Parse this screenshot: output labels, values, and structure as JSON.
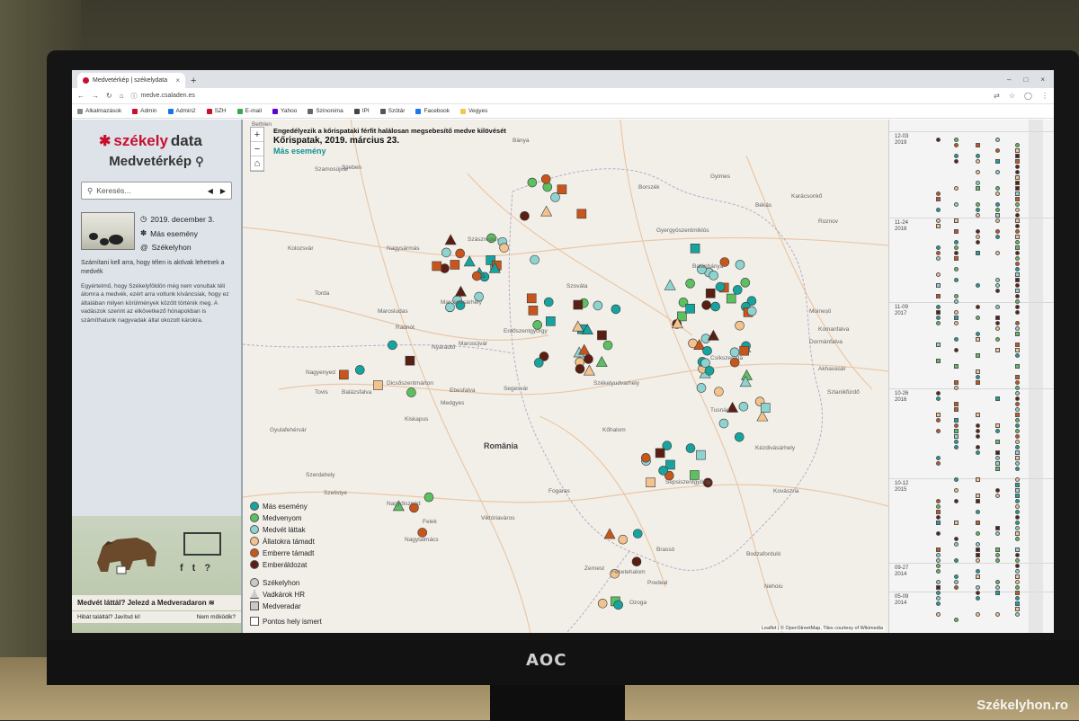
{
  "browser": {
    "tab_title": "Medvetérkép | székelydata",
    "url": "medve.csaladen.es",
    "bookmarks": [
      {
        "label": "Alkalmazások",
        "color": "#888888"
      },
      {
        "label": "Admin",
        "color": "#c8102e"
      },
      {
        "label": "Admin2",
        "color": "#1a73e8"
      },
      {
        "label": "SZH",
        "color": "#c8102e"
      },
      {
        "label": "E-mail",
        "color": "#34a853"
      },
      {
        "label": "Yahoo",
        "color": "#5f01d1"
      },
      {
        "label": "Szinonima",
        "color": "#666666"
      },
      {
        "label": "IPI",
        "color": "#444444"
      },
      {
        "label": "Szótár",
        "color": "#555555"
      },
      {
        "label": "Facebook",
        "color": "#1877f2"
      },
      {
        "label": "Vegyes",
        "color": "#f2c94c"
      }
    ]
  },
  "sidebar": {
    "logo_text_1": "székely",
    "logo_text_2": "data",
    "subtitle": "Medvetérkép",
    "search_placeholder": "Keresés...",
    "event_date": "2019. december 3.",
    "event_type": "Más esemény",
    "event_source": "Székelyhon",
    "lead": "Számítani kell arra, hogy télen is aktívak lehetnek a medvék",
    "body": "Egyértelmű, hogy Székelyföldön még nem vonultak téli álomra a medvék, ezért arra voltunk kíváncsiak, hogy ez általában milyen körülmények között történik meg. A vadászok szerint az elkövetkező hónapokban is számíthatunk nagyvadak által okozott károkra.",
    "cta": "Medvét láttál? Jelezd a Medveradaron",
    "cta_left": "Hibát találtál? Javítsd ki!",
    "cta_right": "Nem működik?",
    "social": [
      "f",
      "t",
      "?"
    ]
  },
  "map": {
    "popup_line1": "Engedélyezik a kőrispataki férfit halálosan megsebesítő medve kilövését",
    "popup_line2": "Kőrispatak, 2019. március 23.",
    "popup_line3": "Más esemény",
    "country_label": "România",
    "attribution": "Leaflet | © OpenStreetMap, Tiles courtesy of Wikimedia",
    "place_labels": [
      {
        "name": "Bethlen"
      },
      {
        "name": "Szamosújvár"
      },
      {
        "name": "Borszék"
      },
      {
        "name": "Karácsonkő"
      },
      {
        "name": "Békás"
      },
      {
        "name": "Gyergyószentmiklós"
      },
      {
        "name": "Roznov"
      },
      {
        "name": "Nagysármás"
      },
      {
        "name": "Kolozsvár"
      },
      {
        "name": "Szászrégen"
      },
      {
        "name": "Marosvásárhely"
      },
      {
        "name": "Torda"
      },
      {
        "name": "Marosludas"
      },
      {
        "name": "Nyárádtő"
      },
      {
        "name": "Radnót"
      },
      {
        "name": "Erdőszentgyörgy"
      },
      {
        "name": "Szováta"
      },
      {
        "name": "Balánbánya"
      },
      {
        "name": "Moinești"
      },
      {
        "name": "Komanfalva"
      },
      {
        "name": "Dormánfalva"
      },
      {
        "name": "Marosújvár"
      },
      {
        "name": "Nagyenyed"
      },
      {
        "name": "Dicsőszentmárton"
      },
      {
        "name": "Székelyudvarhely"
      },
      {
        "name": "Csíkszereda"
      },
      {
        "name": "Akhavasár"
      },
      {
        "name": "Tovis"
      },
      {
        "name": "Balázsfalva"
      },
      {
        "name": "Ebesfalva"
      },
      {
        "name": "Segesvár"
      },
      {
        "name": "Tusnád"
      },
      {
        "name": "Szlanikfürdő"
      },
      {
        "name": "Medgyes"
      },
      {
        "name": "Gyulafehérvár"
      },
      {
        "name": "Kiskapus"
      },
      {
        "name": "Kőhalom"
      },
      {
        "name": "Kézdivásárhely"
      },
      {
        "name": "Szerdahely"
      },
      {
        "name": "Szelistye"
      },
      {
        "name": "Nagydisznód"
      },
      {
        "name": "Fogaras"
      },
      {
        "name": "Sepsiszentgyörgy"
      },
      {
        "name": "Kovászna"
      },
      {
        "name": "Felek"
      },
      {
        "name": "Viktóriaváros"
      },
      {
        "name": "Nagytalmács"
      },
      {
        "name": "Feketehalom"
      },
      {
        "name": "Brassó"
      },
      {
        "name": "Bodzaforduló"
      },
      {
        "name": "Zernest"
      },
      {
        "name": "Predeal"
      },
      {
        "name": "Nehoiu"
      },
      {
        "name": "Ozoga"
      },
      {
        "name": "Szeben"
      },
      {
        "name": "Gyimes"
      },
      {
        "name": "Bánya"
      }
    ],
    "legend": [
      {
        "label": "Más esemény",
        "color": "#17a39e"
      },
      {
        "label": "Medvenyom",
        "color": "#5cbf60"
      },
      {
        "label": "Medvét láttak",
        "color": "#8fd3d0"
      },
      {
        "label": "Állatokra támadt",
        "color": "#f2c28f"
      },
      {
        "label": "Emberre támadt",
        "color": "#c8561c"
      },
      {
        "label": "Emberáldozat",
        "color": "#5a1e12"
      }
    ],
    "legend_sources": [
      {
        "label": "Székelyhon",
        "shape": "circle"
      },
      {
        "label": "Vadkárok HR",
        "shape": "triangle"
      },
      {
        "label": "Medveradar",
        "shape": "square"
      }
    ],
    "legend_exact": "Pontos hely ismert"
  },
  "timeline": {
    "dates": [
      "12-03\n2019",
      "11-24\n2018",
      "11-09\n2017",
      "10-26\n2016",
      "10-12\n2015",
      "09-27\n2014",
      "05-09\n2014"
    ]
  },
  "photo": {
    "monitor_brand": "AOC",
    "watermark": "Székelyhon.ro"
  }
}
